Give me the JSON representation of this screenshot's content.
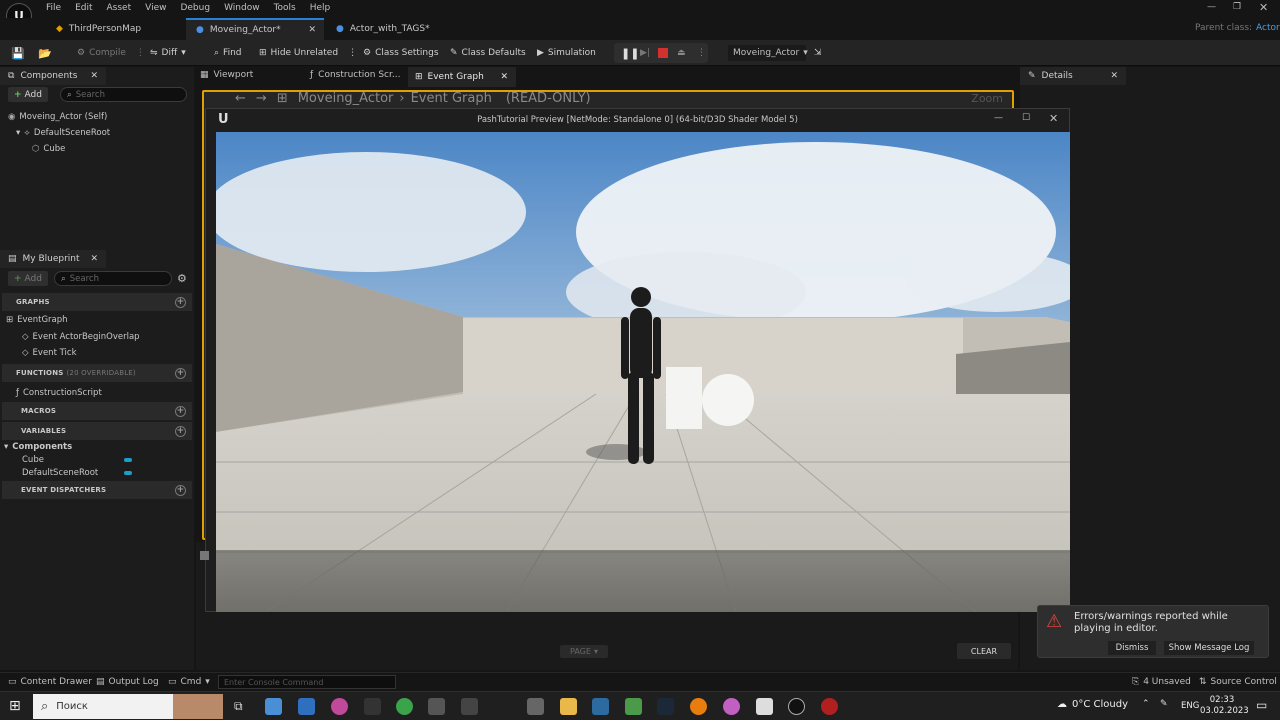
{
  "menu": [
    "File",
    "Edit",
    "Asset",
    "View",
    "Debug",
    "Window",
    "Tools",
    "Help"
  ],
  "parent_class": {
    "label": "Parent class:",
    "value": "Actor"
  },
  "doc_tabs": [
    {
      "label": "ThirdPersonMap"
    },
    {
      "label": "Moveing_Actor*"
    },
    {
      "label": "Actor_with_TAGS*"
    }
  ],
  "toolbar": {
    "compile": "Compile",
    "diff": "Diff",
    "find": "Find",
    "hide_unrelated": "Hide Unrelated",
    "class_settings": "Class Settings",
    "class_defaults": "Class Defaults",
    "simulation": "Simulation",
    "debug_object": "Moveing_Actor"
  },
  "components_panel": {
    "tab": "Components",
    "add": "Add",
    "search_placeholder": "Search",
    "tree": [
      "Moveing_Actor (Self)",
      "DefaultSceneRoot",
      "Cube"
    ]
  },
  "graph_tabs": [
    "Viewport",
    "Construction Scr...",
    "Event Graph"
  ],
  "breadcrumb": {
    "actor": "Moveing_Actor",
    "graph": "Event Graph",
    "mode": "(READ-ONLY)",
    "zoom": "Zoom"
  },
  "details": {
    "tab": "Details"
  },
  "my_blueprint": {
    "tab": "My Blueprint",
    "add": "Add",
    "search_placeholder": "Search",
    "graphs_head": "GRAPHS",
    "event_graph": "EventGraph",
    "events": [
      "Event ActorBeginOverlap",
      "Event Tick"
    ],
    "functions_head": "FUNCTIONS",
    "functions_note": "(20 OVERRIDABLE)",
    "construction_script": "ConstructionScript",
    "macros_head": "MACROS",
    "variables_head": "VARIABLES",
    "components_cat": "Components",
    "variables": [
      "Cube",
      "DefaultSceneRoot"
    ],
    "dispatchers_head": "EVENT DISPATCHERS"
  },
  "game_window": {
    "title": "PashTutorial Preview [NetMode: Standalone 0]  (64-bit/D3D Shader Model 5)"
  },
  "bottom": {
    "page": "PAGE",
    "clear": "CLEAR",
    "content_drawer": "Content Drawer",
    "output_log": "Output Log",
    "cmd": "Cmd",
    "console_placeholder": "Enter Console Command",
    "unsaved": "4 Unsaved",
    "source_control": "Source Control"
  },
  "notification": {
    "text": "Errors/warnings reported while playing in editor.",
    "dismiss": "Dismiss",
    "show_log": "Show Message Log"
  },
  "taskbar": {
    "search": "Поиск",
    "weather": "0°C  Cloudy",
    "lang": "ENG",
    "time": "02:33",
    "date": "03.02.2023"
  },
  "colors": {
    "accent_blue": "#2a7fd6",
    "graph_border": "#e0a000",
    "stop_red": "#d33030",
    "variable_blue": "#1aa0c8"
  }
}
